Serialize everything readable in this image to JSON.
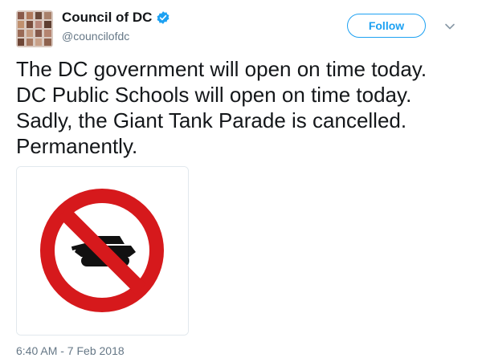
{
  "user": {
    "display_name": "Council of DC",
    "handle": "@councilofdc",
    "verified": true
  },
  "actions": {
    "follow_label": "Follow"
  },
  "tweet": {
    "lines": [
      "The DC government will open on time today.",
      "DC Public Schools will open on time today.",
      "Sadly, the Giant Tank Parade is cancelled.",
      "Permanently."
    ],
    "timestamp": "6:40 AM - 7 Feb 2018"
  },
  "media": {
    "description": "no-tanks-prohibition-sign"
  },
  "colors": {
    "accent": "#1da1f2",
    "secondary_text": "#657786",
    "primary_text": "#14171a",
    "sign_red": "#d6191c"
  }
}
